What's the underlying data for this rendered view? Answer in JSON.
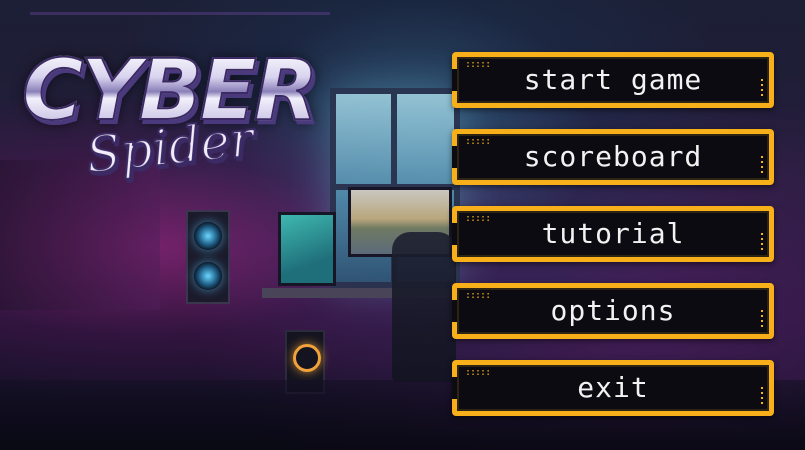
{
  "game": {
    "logo_top": "CYBER",
    "logo_bottom": "Spider"
  },
  "menu": {
    "items": [
      {
        "label": "start game"
      },
      {
        "label": "scoreboard"
      },
      {
        "label": "tutorial"
      },
      {
        "label": "options"
      },
      {
        "label": "exit"
      }
    ]
  },
  "colors": {
    "button_border": "#f7b019",
    "button_fill": "#0c0b11",
    "button_text": "#f2f2f2"
  }
}
